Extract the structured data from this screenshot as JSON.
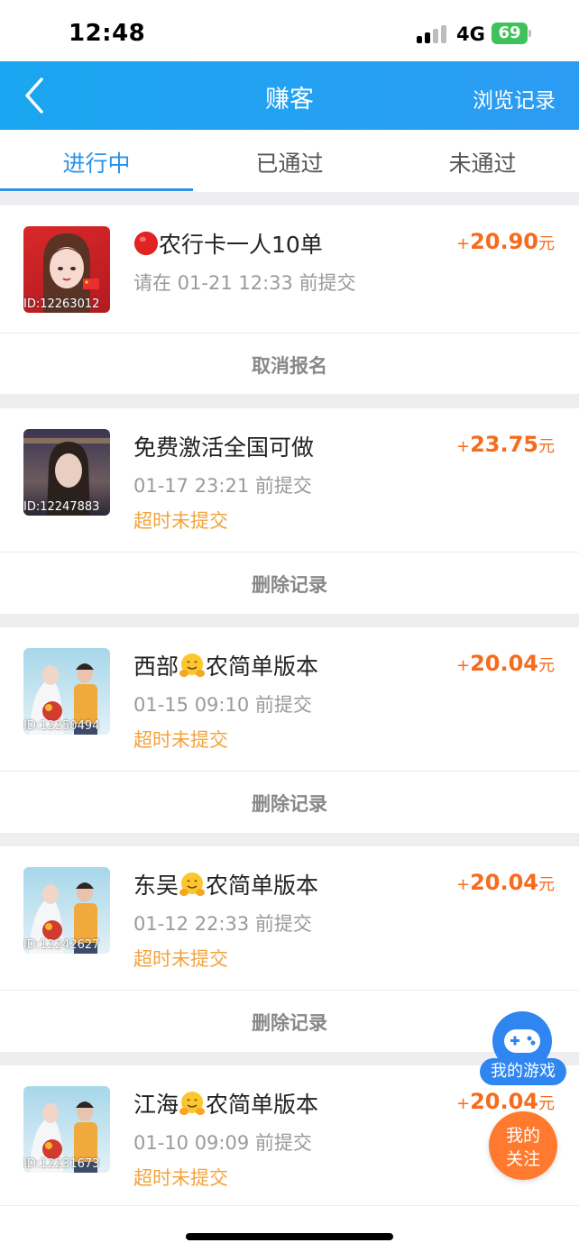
{
  "status_bar": {
    "time": "12:48",
    "network": "4G",
    "battery": "69"
  },
  "nav": {
    "title": "赚客",
    "history_label": "浏览记录"
  },
  "tabs": [
    {
      "label": "进行中",
      "active": true
    },
    {
      "label": "已通过",
      "active": false
    },
    {
      "label": "未通过",
      "active": false
    }
  ],
  "tasks": [
    {
      "title": "农行卡一人10单",
      "title_prefix_icon": "red-circle-icon",
      "date": "请在 01-21 12:33 前提交",
      "status": "",
      "reward_sign": "+",
      "reward": "20.90",
      "unit": "元",
      "avatar_id": "ID:12263012",
      "action": "取消报名"
    },
    {
      "title": "免费激活全国可做",
      "date": "01-17 23:21 前提交",
      "status": "超时未提交",
      "reward_sign": "+",
      "reward": "23.75",
      "unit": "元",
      "avatar_id": "ID:12247883",
      "action": "删除记录"
    },
    {
      "title_a": "西部",
      "title_b": "农简单版本",
      "title_icon": "hugging-face-emoji",
      "date": "01-15 09:10 前提交",
      "status": "超时未提交",
      "reward_sign": "+",
      "reward": "20.04",
      "unit": "元",
      "avatar_id": "ID:12250494",
      "action": "删除记录"
    },
    {
      "title_a": "东吴",
      "title_b": "农简单版本",
      "title_icon": "hugging-face-emoji",
      "date": "01-12 22:33 前提交",
      "status": "超时未提交",
      "reward_sign": "+",
      "reward": "20.04",
      "unit": "元",
      "avatar_id": "ID:12242627",
      "action": "删除记录"
    },
    {
      "title_a": "江海",
      "title_b": "农简单版本",
      "title_icon": "hugging-face-emoji",
      "date": "01-10 09:09 前提交",
      "status": "超时未提交",
      "reward_sign": "+",
      "reward": "20.04",
      "unit": "元",
      "avatar_id": "ID:12231673"
    }
  ],
  "floating": {
    "game_label": "我的游戏",
    "follow_line1": "我的",
    "follow_line2": "关注"
  },
  "colors": {
    "nav_blue": "#1aa6f0",
    "tab_active": "#2a93e8",
    "reward_orange": "#f76b1c",
    "status_orange": "#f3a33a"
  }
}
